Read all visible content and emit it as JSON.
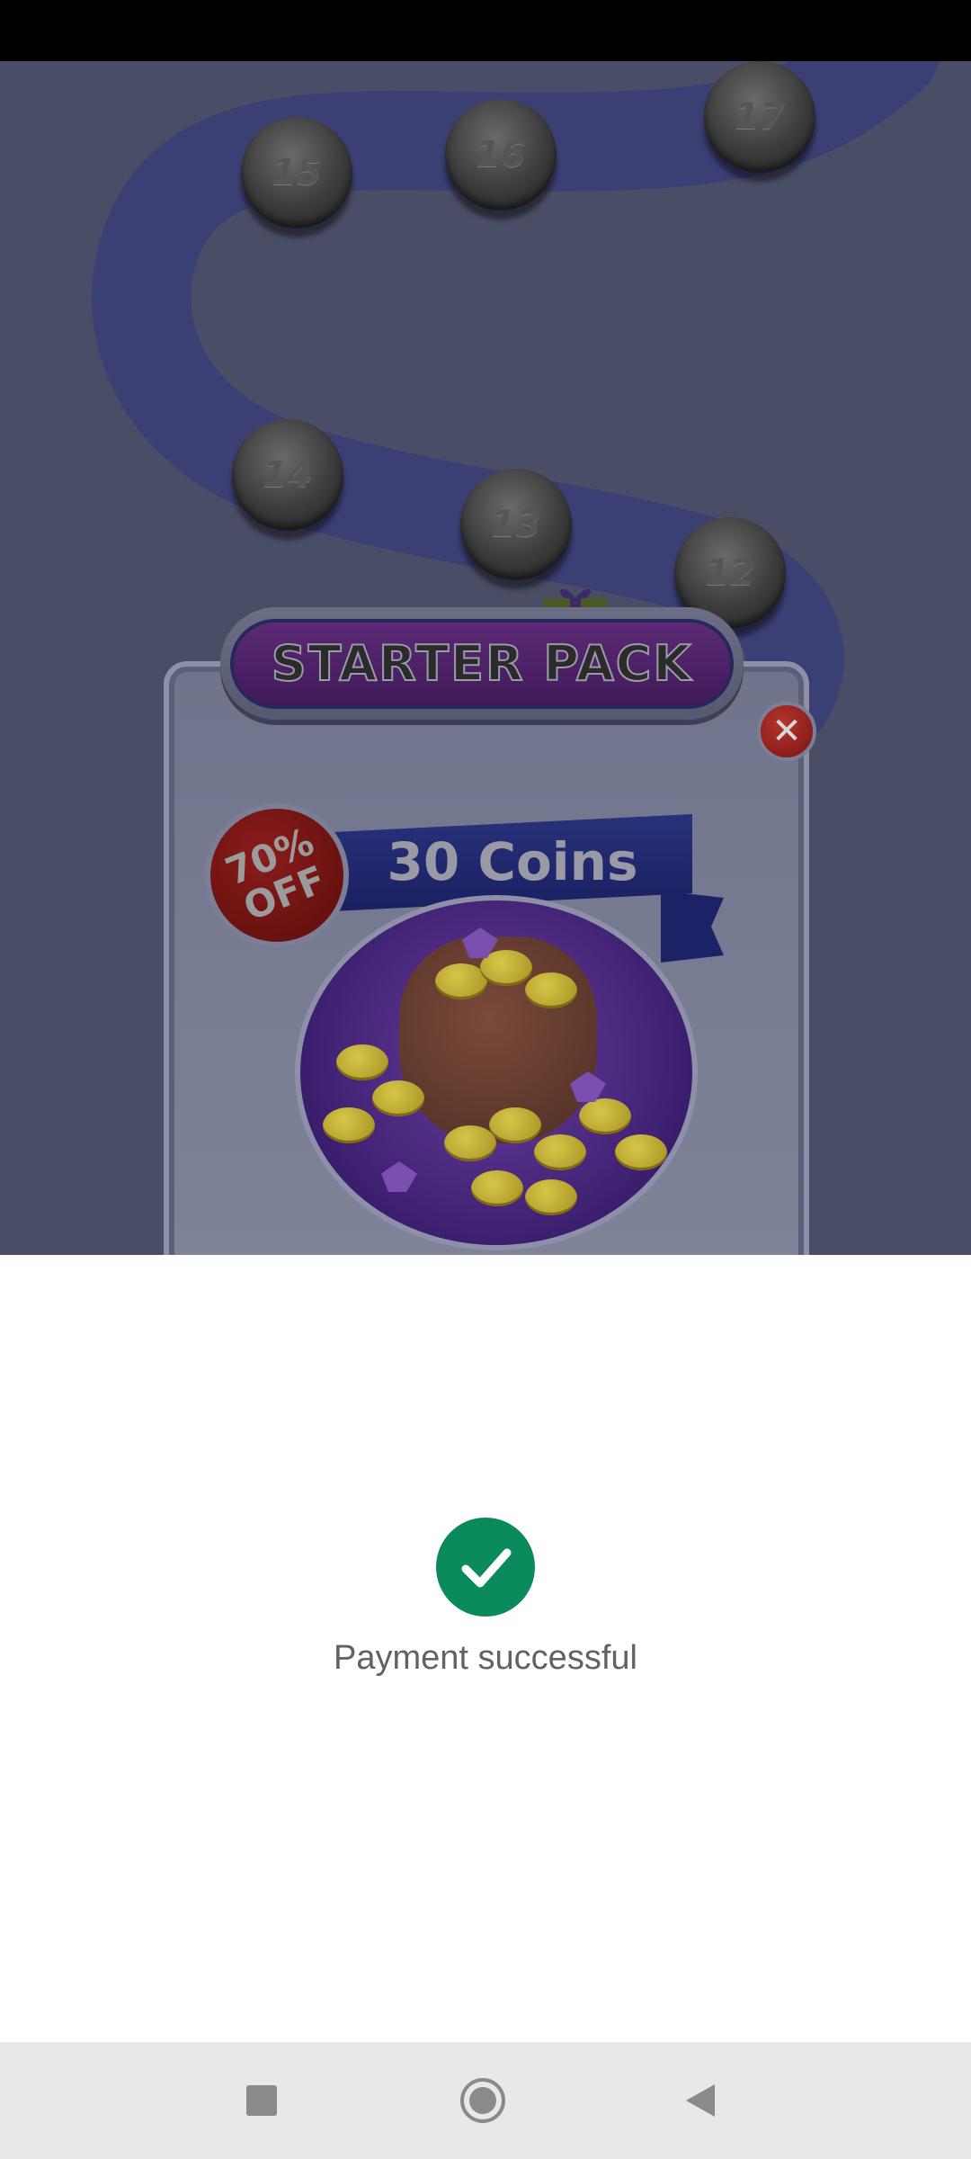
{
  "popup": {
    "title": "STARTER PACK",
    "close_symbol": "✕",
    "discount": "70%\nOFF",
    "reward_label": "30 Coins"
  },
  "levels": [
    "15",
    "16",
    "17",
    "14",
    "13",
    "12"
  ],
  "payment": {
    "status_text": "Payment successful",
    "status_color": "#0b8a5c"
  },
  "icons": {
    "success": "check-circle-icon",
    "nav_recents": "square-icon",
    "nav_home": "circle-icon",
    "nav_back": "triangle-back-icon",
    "gift": "gift-box-icon",
    "close": "close-icon"
  },
  "colors": {
    "overlay_bg": "#4a4d66",
    "nav_bar": "#e8e8e8",
    "status_bar": "#000000"
  }
}
